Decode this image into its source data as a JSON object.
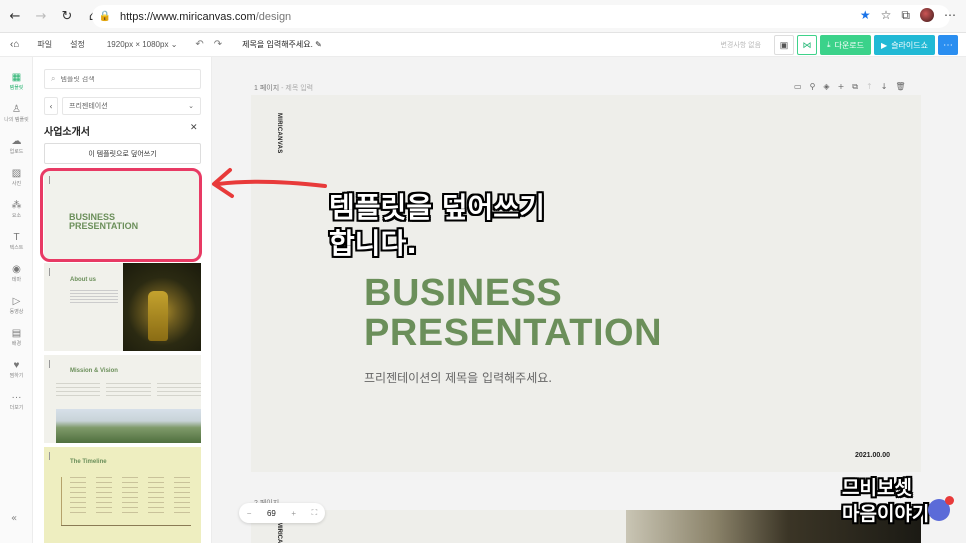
{
  "browser": {
    "url_prefix": "https://www.miricanvas.com",
    "url_path": "/design"
  },
  "toolbar": {
    "file": "파일",
    "settings": "설정",
    "size": "1920px × 1080px",
    "title": "제목을 입력해주세요.",
    "history": "변경사항 없음",
    "download": "다운로드",
    "slideshow": "슬라이드쇼"
  },
  "rail": {
    "items": [
      {
        "label": "템플릿",
        "icon": "template-icon"
      },
      {
        "label": "나의 템플릿",
        "icon": "my-template-icon"
      },
      {
        "label": "업로드",
        "icon": "upload-icon"
      },
      {
        "label": "사진",
        "icon": "photo-icon"
      },
      {
        "label": "요소",
        "icon": "elements-icon"
      },
      {
        "label": "텍스트",
        "icon": "text-icon"
      },
      {
        "label": "테마",
        "icon": "theme-icon"
      },
      {
        "label": "동영상",
        "icon": "video-icon"
      },
      {
        "label": "배경",
        "icon": "background-icon"
      },
      {
        "label": "찜하기",
        "icon": "heart-icon"
      },
      {
        "label": "더보기",
        "icon": "more-icon"
      }
    ]
  },
  "panel": {
    "search_placeholder": "템플릿 검색",
    "category": "프리젠테이션",
    "title": "사업소개서",
    "overwrite_button": "이 템플릿으로 덮어쓰기",
    "thumbs": {
      "t1_title": "BUSINESS\nPRESENTATION",
      "t2_title": "About us",
      "t3_title": "Mission & Vision",
      "t4_title": "The Timeline"
    }
  },
  "canvas": {
    "page1_label_num": "1 페이지",
    "page1_label_title": " - 제목 입력",
    "page2_label": "2 페이지",
    "zoom": "69"
  },
  "slide": {
    "brand": "MIRICANVAS",
    "title_line1": "BUSINESS",
    "title_line2": "PRESENTATION",
    "subtitle": "프리젠테이션의 제목을 입력해주세요.",
    "date": "2021.00.00"
  },
  "annotation": {
    "text": "템플릿을 덮어쓰기\n합니다."
  },
  "watermark": {
    "text": "므비보셋\n마음이야기"
  },
  "colors": {
    "accent_green": "#6b8f5a",
    "download_green": "#3bd28a",
    "slideshow_teal": "#21b9d5",
    "highlight_pink": "#e83a64"
  }
}
